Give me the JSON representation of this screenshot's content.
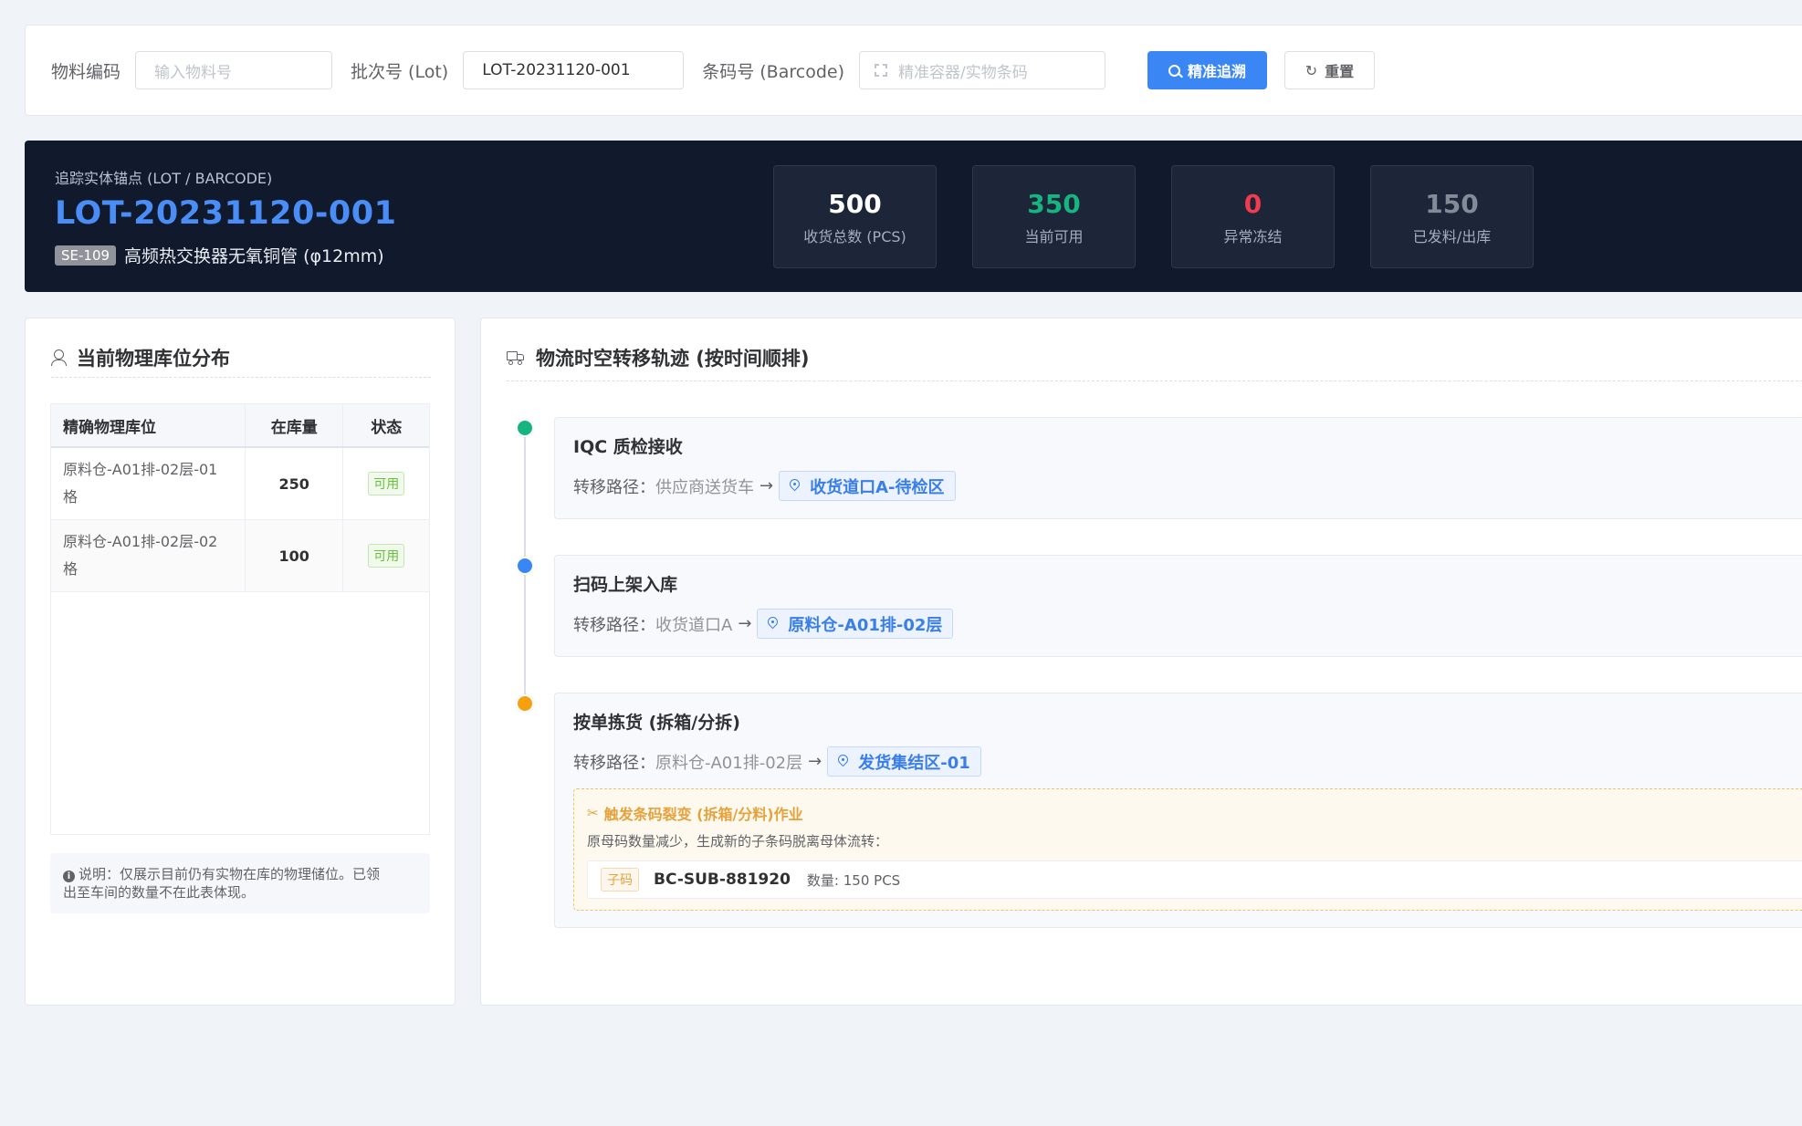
{
  "search": {
    "material_label": "物料编码",
    "material_placeholder": "输入物料号",
    "lot_label": "批次号 (Lot)",
    "lot_value": "LOT-20231120-001",
    "barcode_label": "条码号 (Barcode)",
    "barcode_placeholder": "精准容器/实物条码",
    "trace_button": "精准追溯",
    "reset_button": "重置"
  },
  "anchor": {
    "subtitle": "追踪实体锚点 (LOT / BARCODE)",
    "lot": "LOT-20231120-001",
    "material_code": "SE-109",
    "material_name": "高频热交换器无氧铜管 (φ12mm)",
    "stats": [
      {
        "value": "500",
        "label": "收货总数 (PCS)",
        "color": "#ffffff"
      },
      {
        "value": "350",
        "label": "当前可用",
        "color": "#16b57f"
      },
      {
        "value": "0",
        "label": "异常冻结",
        "color": "#f23b4e"
      },
      {
        "value": "150",
        "label": "已发料/出库",
        "color": "#838b99"
      }
    ]
  },
  "locations": {
    "title": "当前物理库位分布",
    "icon": "user-icon",
    "columns": [
      "精确物理库位",
      "在库量",
      "状态"
    ],
    "rows": [
      {
        "location_line1": "原料仓-A01排-02层-01",
        "location_line2": "格",
        "qty": "250",
        "status": "可用"
      },
      {
        "location_line1": "原料仓-A01排-02层-02",
        "location_line2": "格",
        "qty": "100",
        "status": "可用"
      }
    ],
    "note_line1": "说明：仅展示目前仍有实物在库的物理储位。已领",
    "note_line2": "出至车间的数量不在此表体现。"
  },
  "timeline": {
    "title": "物流时空转移轨迹 (按时间顺排)",
    "icon": "truck-icon",
    "path_label": "转移路径：",
    "events": [
      {
        "title": "IQC 质检接收",
        "from": "供应商送货车",
        "to": "收货道口A-待检区",
        "dot_color": "#16b57f"
      },
      {
        "title": "扫码上架入库",
        "from": "收货道口A",
        "to": "原料仓-A01排-02层",
        "dot_color": "#3a86f5"
      },
      {
        "title": "按单拣货 (拆箱/分拆)",
        "from": "原料仓-A01排-02层",
        "to": "发货集结区-01",
        "dot_color": "#f5a10f"
      }
    ],
    "split": {
      "title": "触发条码裂变 (拆箱/分料)作业",
      "desc": "原母码数量减少，生成新的子条码脱离母体流转：",
      "child_tag": "子码",
      "child_code": "BC-SUB-881920",
      "child_qty": "数量: 150 PCS"
    }
  }
}
